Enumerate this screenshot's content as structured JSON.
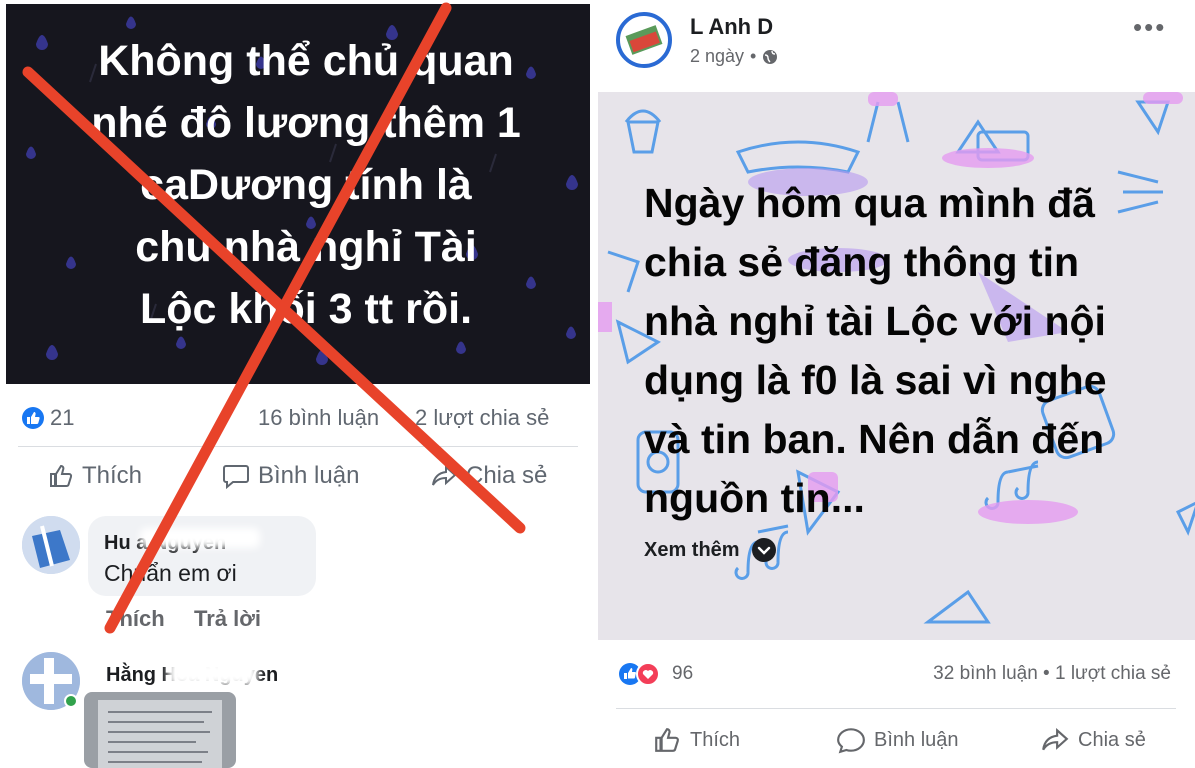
{
  "left_post": {
    "image_text": "Không thể chủ quan\nnhé đô lương thêm 1\ncaDương  tính là\nchủ nhà nghỉ Tài\nLộc khối 3 tt rồi.",
    "reactions_count": "21",
    "comments_count": "16 bình luận",
    "shares_count": "2 lượt chia sẻ",
    "actions": {
      "like": "Thích",
      "comment": "Bình luận",
      "share": "Chia sẻ"
    },
    "comments": [
      {
        "name": "Hu  a Nguyen",
        "text": "Chuẩn em ơi",
        "like": "Thích",
        "reply": "Trả lời"
      },
      {
        "name": "Hằng Hoa Nguyen"
      }
    ],
    "colors": {
      "cross": "#e8432a",
      "card": "#16161e",
      "drops": "#3b3aa0"
    }
  },
  "right_post": {
    "page_name": "L     Anh D",
    "time": "2 ngày",
    "more": "•••",
    "post_text": "Ngày hôm qua mình đã\nchia sẻ đăng thông tin\nnhà nghỉ tài Lộc với nội\ndụng là f0 là sai  vì nghe\nvà tin ban. Nên dẫn đến\nnguồn tin...",
    "see_more": "Xem thêm",
    "reactions_count": "96",
    "comments_count": "32 bình luận",
    "separator": "•",
    "shares_count": "1 lượt chia sẻ",
    "actions": {
      "like": "Thích",
      "comment": "Bình luận",
      "share": "Chia sẻ"
    },
    "colors": {
      "background": "#e7e4ea",
      "deco_blue": "#5a9ee8",
      "deco_pink": "#e59bf0",
      "deco_purple": "#b89af0"
    }
  }
}
